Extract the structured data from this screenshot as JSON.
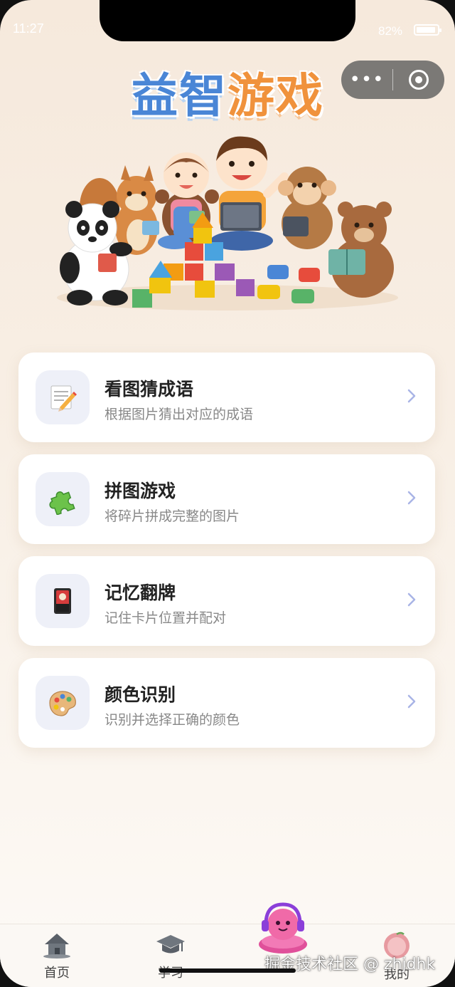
{
  "status_bar": {
    "time": "11:27",
    "battery": "82%",
    "battery_level": 0.82
  },
  "capsule": {
    "more_icon": "more-dots-icon",
    "close_icon": "target-icon"
  },
  "header": {
    "title_part1": "益智",
    "title_part2": "游戏"
  },
  "games": [
    {
      "title": "看图猜成语",
      "desc": "根据图片猜出对应的成语",
      "icon": "memo-pencil-icon"
    },
    {
      "title": "拼图游戏",
      "desc": "将碎片拼成完整的图片",
      "icon": "puzzle-piece-icon"
    },
    {
      "title": "记忆翻牌",
      "desc": "记住卡片位置并配对",
      "icon": "flower-card-icon"
    },
    {
      "title": "颜色识别",
      "desc": "识别并选择正确的颜色",
      "icon": "palette-icon"
    }
  ],
  "tabbar": {
    "items": [
      {
        "label": "首页",
        "icon": "house-icon"
      },
      {
        "label": "学习",
        "icon": "graduation-cap-icon"
      },
      {
        "label": "游戏",
        "icon": "headphone-mascot-icon"
      },
      {
        "label": "我的",
        "icon": "peach-avatar-icon"
      }
    ]
  },
  "watermark": "掘金技术社区 @ zhjdhk",
  "colors": {
    "title_blue": "#4a86d6",
    "title_orange": "#f0923c",
    "chevron": "#a9b4e6"
  }
}
